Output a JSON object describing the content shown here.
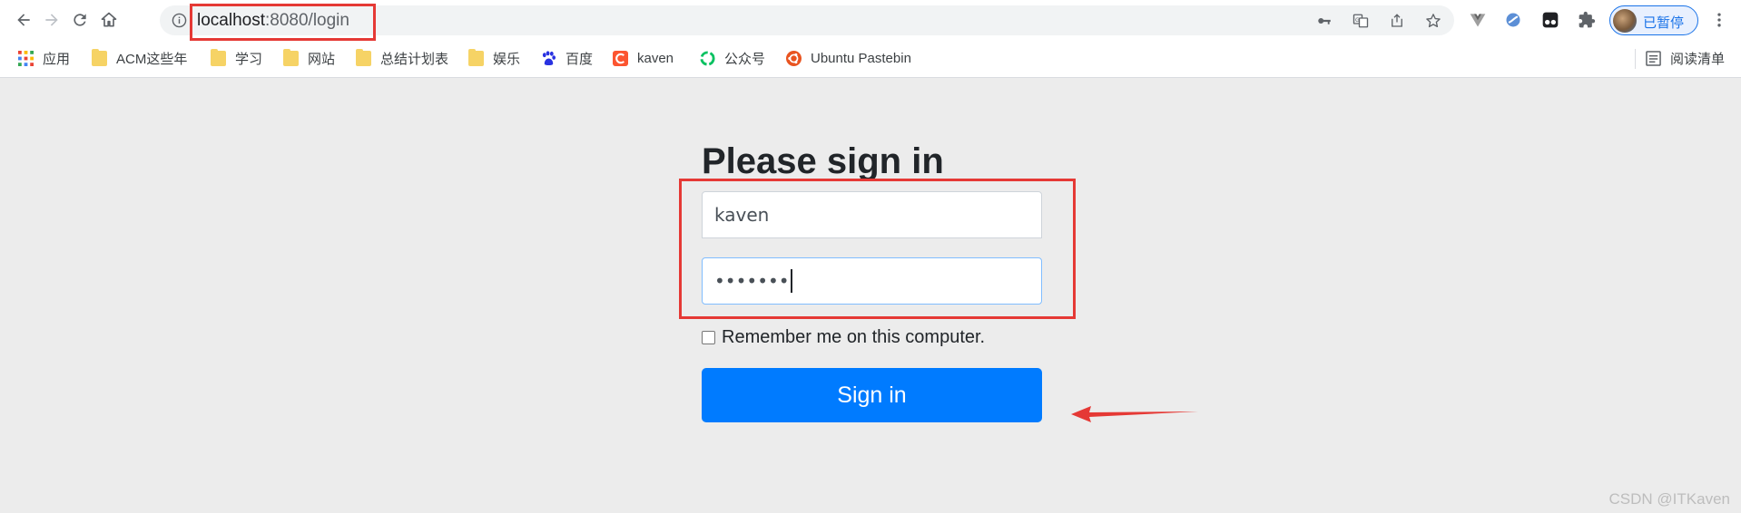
{
  "browser": {
    "url_host": "localhost",
    "url_path": ":8080/login",
    "profile_label": "已暂停"
  },
  "bookmarks": [
    {
      "label": "应用",
      "icon": "apps-grid-icon"
    },
    {
      "label": "ACM这些年",
      "icon": "folder-icon"
    },
    {
      "label": "学习",
      "icon": "folder-icon"
    },
    {
      "label": "网站",
      "icon": "folder-icon"
    },
    {
      "label": "总结计划表",
      "icon": "folder-icon"
    },
    {
      "label": "娱乐",
      "icon": "folder-icon"
    },
    {
      "label": "百度",
      "icon": "baidu-icon"
    },
    {
      "label": "kaven",
      "icon": "csdn-icon"
    },
    {
      "label": "公众号",
      "icon": "wechat-icon"
    },
    {
      "label": "Ubuntu Pastebin",
      "icon": "ubuntu-icon"
    }
  ],
  "reading_list": "阅读清单",
  "login": {
    "heading": "Please sign in",
    "username_value": "kaven",
    "password_mask": "•••••••",
    "remember_label": "Remember me on this computer.",
    "signin_label": "Sign in"
  },
  "watermark": "CSDN @ITKaven",
  "colors": {
    "primary": "#007bff",
    "annotation": "#e53935",
    "page_bg": "#ececec"
  }
}
